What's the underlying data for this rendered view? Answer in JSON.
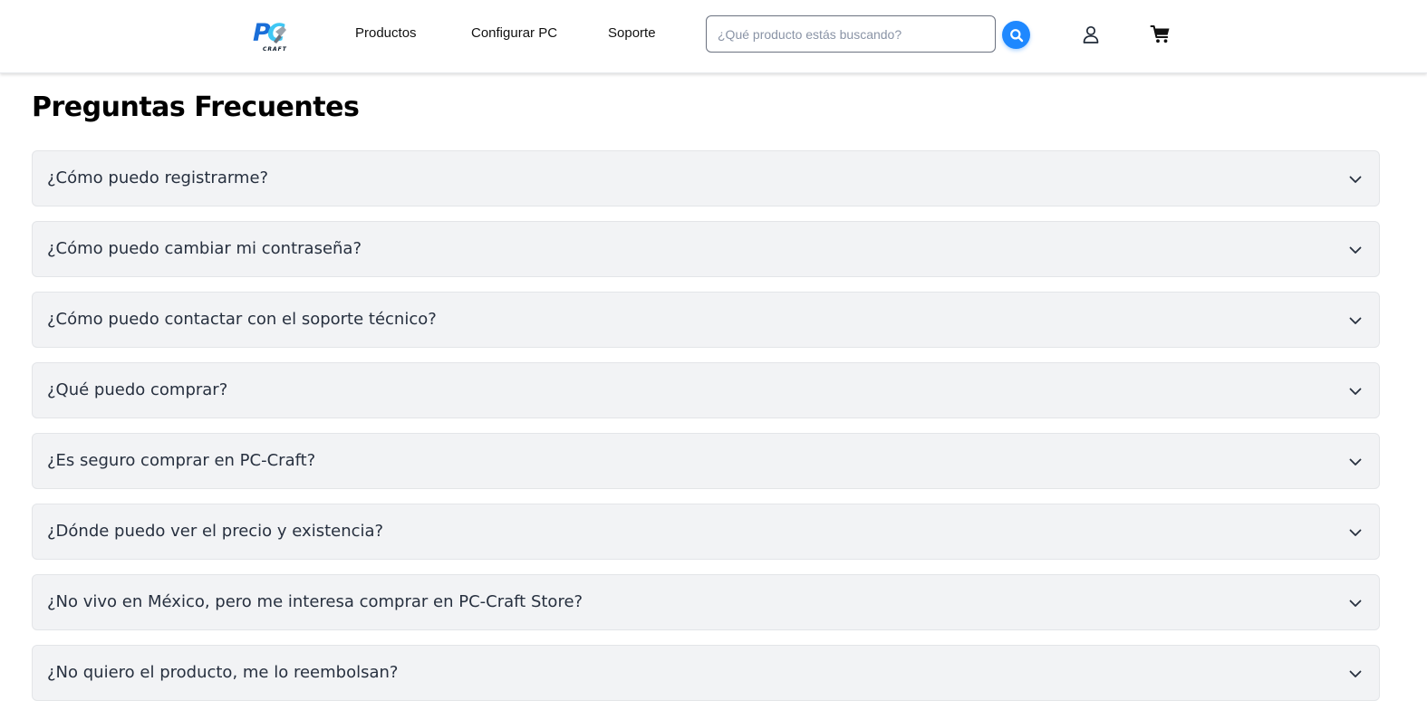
{
  "header": {
    "logo_text": "PC",
    "logo_subtext": "CRAFT",
    "nav": [
      {
        "label": "Productos"
      },
      {
        "label": "Configurar PC"
      },
      {
        "label": "Soporte"
      }
    ],
    "search": {
      "placeholder": "¿Qué producto estás buscando?",
      "value": "",
      "button_icon": "search-icon"
    },
    "user_icon": "user-icon",
    "cart_icon": "cart-icon"
  },
  "faq": {
    "title": "Preguntas Frecuentes",
    "chevron_icon": "chevron-down-icon",
    "items": [
      {
        "question": "¿Cómo puedo registrarme?"
      },
      {
        "question": "¿Cómo puedo cambiar mi contraseña?"
      },
      {
        "question": "¿Cómo puedo contactar con el soporte técnico?"
      },
      {
        "question": "¿Qué puedo comprar?"
      },
      {
        "question": "¿Es seguro comprar en PC-Craft?"
      },
      {
        "question": "¿Dónde puedo ver el precio y existencia?"
      },
      {
        "question": "¿No vivo en México, pero me interesa comprar en PC-Craft Store?"
      },
      {
        "question": "¿No quiero el producto, me lo reembolsan?"
      }
    ]
  },
  "colors": {
    "accent": "#1e88ff",
    "logo_blue": "#1a6ed8",
    "logo_cyan": "#3fc7f4",
    "card_bg": "#f2f3f5",
    "text_dark": "#27303f"
  }
}
